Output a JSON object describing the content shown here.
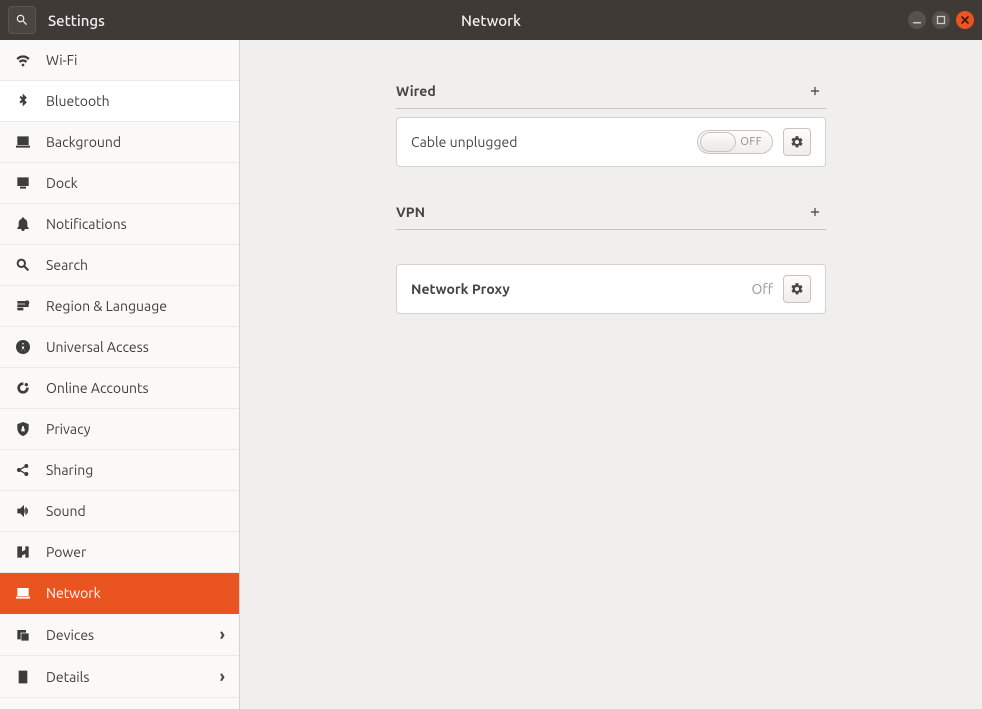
{
  "titlebar": {
    "app_title": "Settings",
    "page_title": "Network"
  },
  "sidebar": {
    "items": [
      {
        "label": "Wi-Fi",
        "icon": "wifi",
        "active": false,
        "highlight": false,
        "chevron": false
      },
      {
        "label": "Bluetooth",
        "icon": "bluetooth",
        "active": false,
        "highlight": true,
        "chevron": false
      },
      {
        "label": "Background",
        "icon": "monitor",
        "active": false,
        "highlight": false,
        "chevron": false
      },
      {
        "label": "Dock",
        "icon": "dock",
        "active": false,
        "highlight": false,
        "chevron": false
      },
      {
        "label": "Notifications",
        "icon": "bell",
        "active": false,
        "highlight": false,
        "chevron": false
      },
      {
        "label": "Search",
        "icon": "search",
        "active": false,
        "highlight": false,
        "chevron": false
      },
      {
        "label": "Region & Language",
        "icon": "region",
        "active": false,
        "highlight": false,
        "chevron": false
      },
      {
        "label": "Universal Access",
        "icon": "accessibility",
        "active": false,
        "highlight": false,
        "chevron": false
      },
      {
        "label": "Online Accounts",
        "icon": "accounts",
        "active": false,
        "highlight": false,
        "chevron": false
      },
      {
        "label": "Privacy",
        "icon": "privacy",
        "active": false,
        "highlight": false,
        "chevron": false
      },
      {
        "label": "Sharing",
        "icon": "share",
        "active": false,
        "highlight": false,
        "chevron": false
      },
      {
        "label": "Sound",
        "icon": "sound",
        "active": false,
        "highlight": false,
        "chevron": false
      },
      {
        "label": "Power",
        "icon": "power",
        "active": false,
        "highlight": false,
        "chevron": false
      },
      {
        "label": "Network",
        "icon": "network",
        "active": true,
        "highlight": false,
        "chevron": false
      },
      {
        "label": "Devices",
        "icon": "devices",
        "active": false,
        "highlight": false,
        "chevron": true
      },
      {
        "label": "Details",
        "icon": "details",
        "active": false,
        "highlight": false,
        "chevron": true
      }
    ]
  },
  "main": {
    "wired": {
      "title": "Wired",
      "status": "Cable unplugged",
      "toggle": "OFF"
    },
    "vpn": {
      "title": "VPN"
    },
    "proxy": {
      "title": "Network Proxy",
      "status": "Off"
    }
  }
}
